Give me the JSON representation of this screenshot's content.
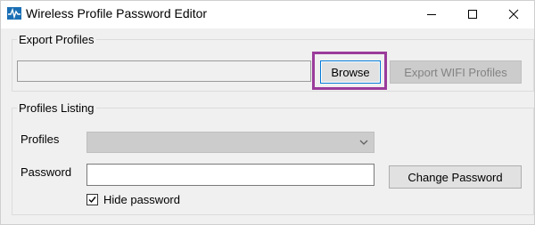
{
  "window": {
    "title": "Wireless Profile Password Editor",
    "icon": "pulse-icon",
    "accent": "#0078d7",
    "highlight_color": "#9b3b9b"
  },
  "export_group": {
    "title": "Export Profiles",
    "path_value": "",
    "browse_label": "Browse",
    "export_label": "Export WIFI Profiles",
    "export_enabled": false
  },
  "listing_group": {
    "title": "Profiles Listing",
    "profiles_label": "Profiles",
    "profiles_selected": "",
    "profiles_enabled": false,
    "password_label": "Password",
    "password_value": "",
    "change_password_label": "Change Password",
    "hide_password_label": "Hide password",
    "hide_password_checked": true
  }
}
